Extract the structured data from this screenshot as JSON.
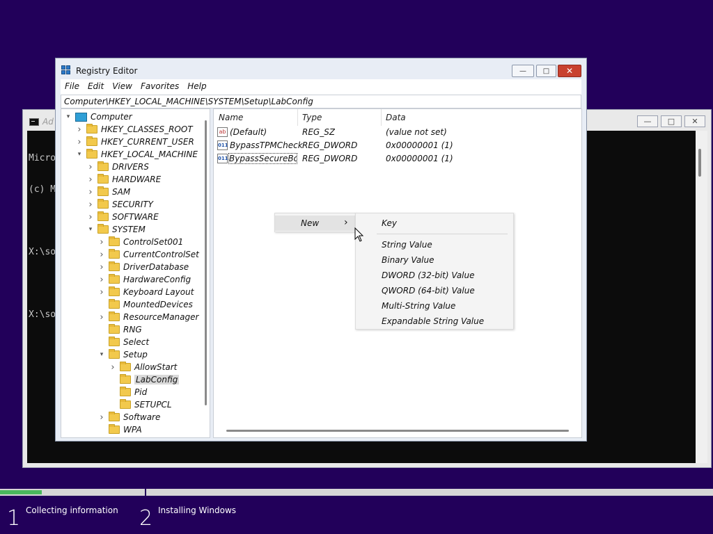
{
  "console": {
    "title": "Ad",
    "lines": [
      "Micro",
      "(c) M",
      "",
      "X:\\so",
      "",
      "X:\\so"
    ],
    "minimize_glyph": "—",
    "restore_glyph": "□",
    "close_glyph": "✕"
  },
  "regedit": {
    "title": "Registry Editor",
    "minimize_glyph": "—",
    "restore_glyph": "□",
    "close_glyph": "✕",
    "menu": [
      "File",
      "Edit",
      "View",
      "Favorites",
      "Help"
    ],
    "address": "Computer\\HKEY_LOCAL_MACHINE\\SYSTEM\\Setup\\LabConfig",
    "tree": [
      {
        "label": "Computer",
        "depth": 0,
        "arrow": "v",
        "icon": "computer-icon"
      },
      {
        "label": "HKEY_CLASSES_ROOT",
        "depth": 1,
        "arrow": ">",
        "icon": "folder-icon"
      },
      {
        "label": "HKEY_CURRENT_USER",
        "depth": 1,
        "arrow": ">",
        "icon": "folder-icon"
      },
      {
        "label": "HKEY_LOCAL_MACHINE",
        "depth": 1,
        "arrow": "v",
        "icon": "folder-icon"
      },
      {
        "label": "DRIVERS",
        "depth": 2,
        "arrow": ">",
        "icon": "folder-icon"
      },
      {
        "label": "HARDWARE",
        "depth": 2,
        "arrow": ">",
        "icon": "folder-icon"
      },
      {
        "label": "SAM",
        "depth": 2,
        "arrow": ">",
        "icon": "folder-icon"
      },
      {
        "label": "SECURITY",
        "depth": 2,
        "arrow": ">",
        "icon": "folder-icon"
      },
      {
        "label": "SOFTWARE",
        "depth": 2,
        "arrow": ">",
        "icon": "folder-icon"
      },
      {
        "label": "SYSTEM",
        "depth": 2,
        "arrow": "v",
        "icon": "folder-icon"
      },
      {
        "label": "ControlSet001",
        "depth": 3,
        "arrow": ">",
        "icon": "folder-icon"
      },
      {
        "label": "CurrentControlSet",
        "depth": 3,
        "arrow": ">",
        "icon": "folder-icon"
      },
      {
        "label": "DriverDatabase",
        "depth": 3,
        "arrow": ">",
        "icon": "folder-icon"
      },
      {
        "label": "HardwareConfig",
        "depth": 3,
        "arrow": ">",
        "icon": "folder-icon"
      },
      {
        "label": "Keyboard Layout",
        "depth": 3,
        "arrow": ">",
        "icon": "folder-icon"
      },
      {
        "label": "MountedDevices",
        "depth": 3,
        "arrow": "",
        "icon": "folder-icon"
      },
      {
        "label": "ResourceManager",
        "depth": 3,
        "arrow": ">",
        "icon": "folder-icon"
      },
      {
        "label": "RNG",
        "depth": 3,
        "arrow": "",
        "icon": "folder-icon"
      },
      {
        "label": "Select",
        "depth": 3,
        "arrow": "",
        "icon": "folder-icon"
      },
      {
        "label": "Setup",
        "depth": 3,
        "arrow": "v",
        "icon": "folder-icon"
      },
      {
        "label": "AllowStart",
        "depth": 4,
        "arrow": ">",
        "icon": "folder-icon"
      },
      {
        "label": "LabConfig",
        "depth": 4,
        "arrow": "",
        "icon": "folder-icon",
        "selected": true
      },
      {
        "label": "Pid",
        "depth": 4,
        "arrow": "",
        "icon": "folder-icon"
      },
      {
        "label": "SETUPCL",
        "depth": 4,
        "arrow": "",
        "icon": "folder-icon"
      },
      {
        "label": "Software",
        "depth": 3,
        "arrow": ">",
        "icon": "folder-icon"
      },
      {
        "label": "WPA",
        "depth": 3,
        "arrow": "",
        "icon": "folder-icon"
      }
    ],
    "columns": [
      "Name",
      "Type",
      "Data"
    ],
    "values": [
      {
        "name": "(Default)",
        "type": "REG_SZ",
        "data": "(value not set)",
        "icon": "string-value-icon",
        "glyph": "ab"
      },
      {
        "name": "BypassTPMCheck",
        "type": "REG_DWORD",
        "data": "0x00000001 (1)",
        "icon": "binary-value-icon",
        "glyph": "011"
      },
      {
        "name": "BypassSecureBo...",
        "type": "REG_DWORD",
        "data": "0x00000001 (1)",
        "icon": "binary-value-icon",
        "glyph": "011",
        "focused": true
      }
    ]
  },
  "context_menu": {
    "new_label": "New",
    "submenu_glyph": "›",
    "submenu": {
      "key": "Key",
      "items": [
        "String Value",
        "Binary Value",
        "DWORD (32-bit) Value",
        "QWORD (64-bit) Value",
        "Multi-String Value",
        "Expandable String Value"
      ]
    }
  },
  "setup": {
    "progress": 0.29,
    "steps": [
      {
        "num": "1",
        "label": "Collecting information"
      },
      {
        "num": "2",
        "label": "Installing Windows"
      }
    ],
    "accent": "#4ab85d",
    "background": "#22005a"
  }
}
